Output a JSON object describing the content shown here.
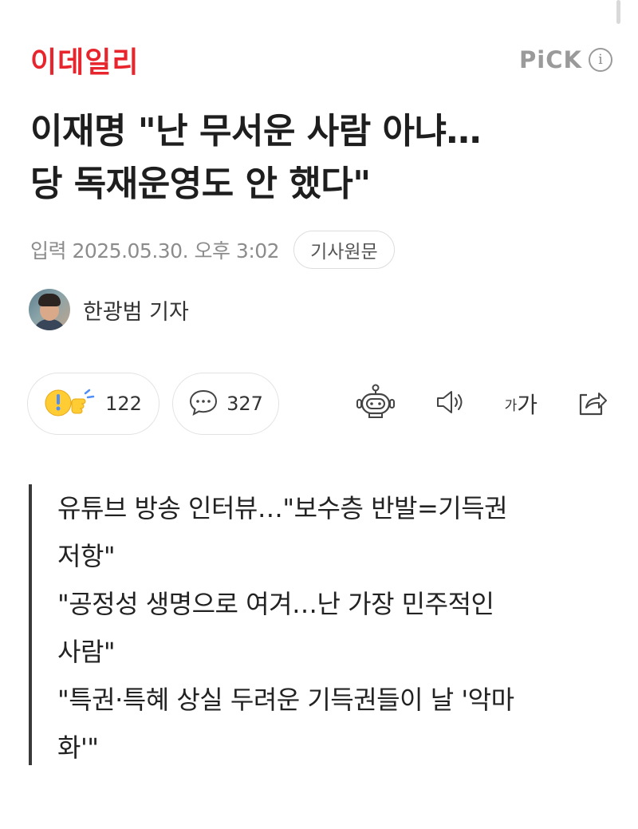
{
  "press": {
    "logo_text": "이데일리",
    "pick_label": "PiCK",
    "brand_color": "#e8242c"
  },
  "article": {
    "title_line1": "이재명 \"난 무서운 사람 아냐…",
    "title_line2": "당 독재운영도 안 했다\"",
    "published": "입력 2025.05.30. 오후 3:02",
    "origin_button": "기사원문",
    "reporter": "한광범 기자"
  },
  "actions": {
    "reaction_count": "122",
    "comment_count": "327",
    "font_label_small": "가",
    "font_label_large": "가"
  },
  "summary": {
    "lines": [
      "유튜브 방송 인터뷰…\"보수층 반발=기득권",
      "저항\"",
      "\"공정성 생명으로 여겨…난 가장 민주적인",
      "사람\"",
      "\"특권·특혜 상실 두려운 기득권들이 날 '악마",
      "화'\""
    ]
  },
  "icons": {
    "info": "info-icon",
    "reaction": "reaction-emoji-icon",
    "comment": "comment-bubble-icon",
    "summary_bot": "ai-summary-bot-icon",
    "speaker": "speaker-icon",
    "share": "share-icon"
  }
}
